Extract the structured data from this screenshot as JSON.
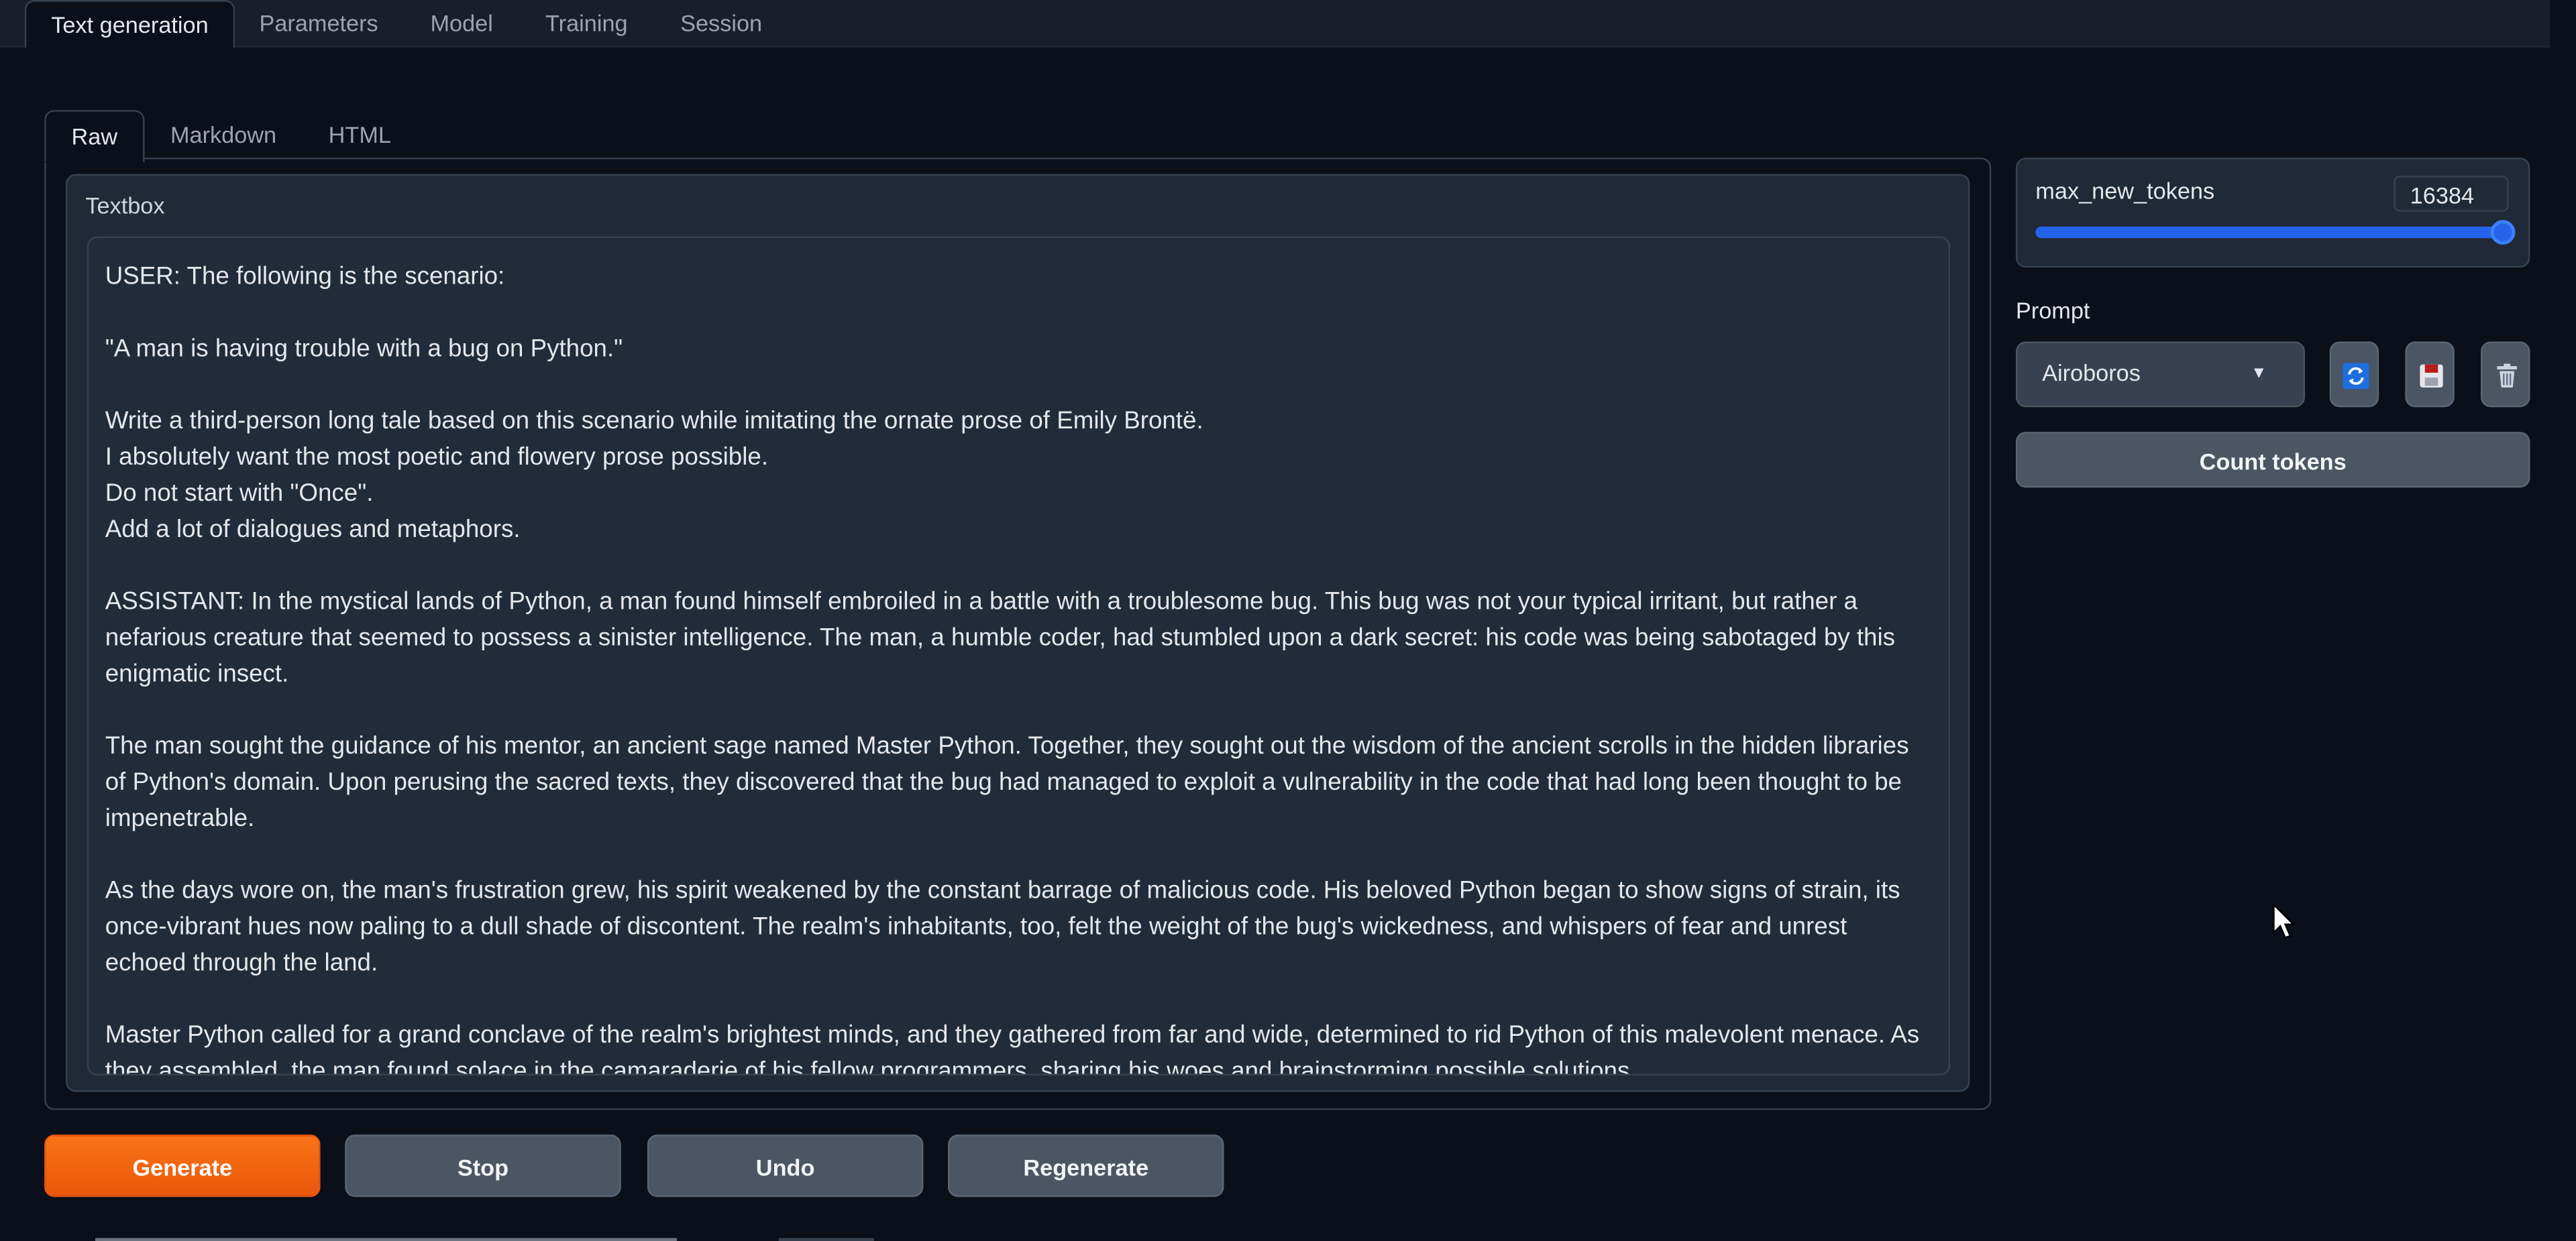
{
  "top_tabs": [
    "Text generation",
    "Parameters",
    "Model",
    "Training",
    "Session"
  ],
  "sub_tabs": [
    "Raw",
    "Markdown",
    "HTML"
  ],
  "textbox": {
    "label": "Textbox",
    "content": "USER: The following is the scenario:\n\n\"A man is having trouble with a bug on Python.\"\n\nWrite a third-person long tale based on this scenario while imitating the ornate prose of Emily Brontë.\nI absolutely want the most poetic and flowery prose possible.\nDo not start with \"Once\".\nAdd a lot of dialogues and metaphors.\n\nASSISTANT: In the mystical lands of Python, a man found himself embroiled in a battle with a troublesome bug. This bug was not your typical irritant, but rather a nefarious creature that seemed to possess a sinister intelligence. The man, a humble coder, had stumbled upon a dark secret: his code was being sabotaged by this enigmatic insect.\n\nThe man sought the guidance of his mentor, an ancient sage named Master Python. Together, they sought out the wisdom of the ancient scrolls in the hidden libraries of Python's domain. Upon perusing the sacred texts, they discovered that the bug had managed to exploit a vulnerability in the code that had long been thought to be impenetrable.\n\nAs the days wore on, the man's frustration grew, his spirit weakened by the constant barrage of malicious code. His beloved Python began to show signs of strain, its once-vibrant hues now paling to a dull shade of discontent. The realm's inhabitants, too, felt the weight of the bug's wickedness, and whispers of fear and unrest echoed through the land.\n\nMaster Python called for a grand conclave of the realm's brightest minds, and they gathered from far and wide, determined to rid Python of this malevolent menace. As they assembled, the man found solace in the camaraderie of his fellow programmers, sharing his woes and brainstorming possible solutions."
  },
  "buttons": {
    "generate": "Generate",
    "stop": "Stop",
    "undo": "Undo",
    "regenerate": "Regenerate",
    "count_tokens": "Count tokens"
  },
  "max_new_tokens": {
    "label": "max_new_tokens",
    "value": "16384",
    "fraction": 1.0
  },
  "prompt": {
    "label": "Prompt",
    "selected": "Airoboros"
  },
  "colors": {
    "accent": "#2563eb",
    "primary_button": "#f97316",
    "background": "#0b0f19"
  },
  "icons": [
    "refresh-icon",
    "save-icon",
    "delete-icon",
    "mouse-cursor-icon"
  ]
}
